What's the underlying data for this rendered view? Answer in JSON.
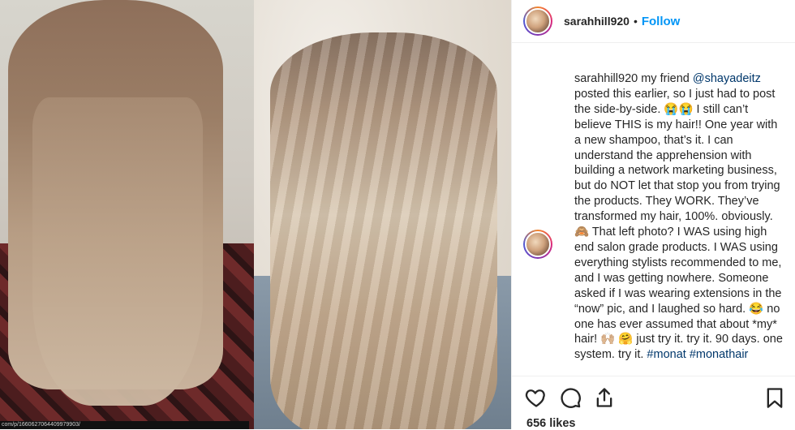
{
  "post": {
    "username": "sarahhill920",
    "separator": "•",
    "follow_label": "Follow"
  },
  "caption": {
    "username": "sarahhill920",
    "part1": " my friend ",
    "mention": "@shayadeitz",
    "part2": " posted this earlier, so I just had to post the side-by-side. 😭😭 I still can’t believe THIS is my hair!! One year with a new shampoo, that’s it. I can understand the apprehension with building a network marketing business, but do NOT let that stop you from trying the products. They WORK. They’ve transformed my hair, 100%. obviously. 🙈 That left photo? I WAS using high end salon grade products. I WAS using everything stylists recommended to me, and I was getting nowhere. Someone asked if I was wearing extensions in the “now” pic, and I laughed so hard. 😂 no one has ever assumed that about *my* hair! 🙌🏼 🤗 just try it. try it. 90 days. one system. try it. ",
    "tag1": "#monat",
    "tag2": "#monathair"
  },
  "photo": {
    "watermark": "com/p/1660627064409979903/"
  },
  "actions": {
    "like_icon": "heart-icon",
    "comment_icon": "comment-icon",
    "share_icon": "share-icon",
    "save_icon": "bookmark-icon",
    "likes": "656 likes"
  },
  "colors": {
    "accent": "#0095f6",
    "link": "#00376b",
    "text": "#262626"
  }
}
